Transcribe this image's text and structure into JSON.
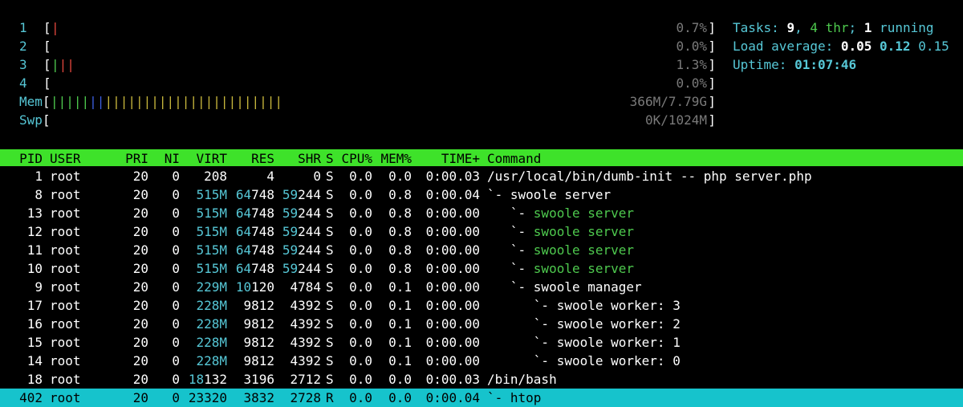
{
  "meters": {
    "cpu1": {
      "label": "1",
      "value": "0.7%",
      "bars": [
        {
          "c": "red",
          "n": 1
        }
      ]
    },
    "cpu2": {
      "label": "2",
      "value": "0.0%",
      "bars": []
    },
    "cpu3": {
      "label": "3",
      "value": "1.3%",
      "bars": [
        {
          "c": "grn",
          "n": 1
        },
        {
          "c": "red",
          "n": 2
        }
      ]
    },
    "cpu4": {
      "label": "4",
      "value": "0.0%",
      "bars": []
    },
    "mem": {
      "label": "Mem",
      "value": "366M/7.79G",
      "bars": [
        {
          "c": "grn",
          "n": 5
        },
        {
          "c": "blu",
          "n": 2
        },
        {
          "c": "yel",
          "n": 23
        }
      ]
    },
    "swp": {
      "label": "Swp",
      "value": "0K/1024M",
      "bars": []
    },
    "bar_char": "|",
    "bracket_open": "[",
    "bracket_close": "]"
  },
  "stats": {
    "tasks_label": "Tasks: ",
    "tasks": "9",
    "sep1": ", ",
    "threads": "4",
    "thr_label": " thr",
    "sep2": "; ",
    "running": "1",
    "running_label": " running",
    "load_label": "Load average: ",
    "load1": "0.05",
    "load5": "0.12",
    "load15": "0.15",
    "uptime_label": "Uptime: ",
    "uptime": "01:07:46"
  },
  "columns": {
    "pid": "PID",
    "user": "USER",
    "pri": "PRI",
    "ni": "NI",
    "virt": "VIRT",
    "res": "RES",
    "shr": "SHR",
    "s": "S",
    "cpu": "CPU%",
    "mem": "MEM%",
    "time": "TIME+",
    "command": "Command"
  },
  "processes": [
    {
      "pid": "1",
      "user": "root",
      "pri": "20",
      "ni": "0",
      "virt": "208",
      "res": "4",
      "shr": "0",
      "s": "S",
      "cpu": "0.0",
      "mem": "0.0",
      "time": "0:00.03",
      "tree": "",
      "cmd": "/usr/local/bin/dumb-init -- php server.php",
      "cmd_color": "white"
    },
    {
      "pid": "8",
      "user": "root",
      "pri": "20",
      "ni": "0",
      "virt": "515M",
      "res": "64748",
      "shr": "59244",
      "s": "S",
      "cpu": "0.0",
      "mem": "0.8",
      "time": "0:00.04",
      "tree": "`- ",
      "cmd": "swoole server",
      "cmd_color": "white"
    },
    {
      "pid": "13",
      "user": "root",
      "pri": "20",
      "ni": "0",
      "virt": "515M",
      "res": "64748",
      "shr": "59244",
      "s": "S",
      "cpu": "0.0",
      "mem": "0.8",
      "time": "0:00.00",
      "tree": "   `- ",
      "cmd": "swoole server",
      "cmd_color": "green"
    },
    {
      "pid": "12",
      "user": "root",
      "pri": "20",
      "ni": "0",
      "virt": "515M",
      "res": "64748",
      "shr": "59244",
      "s": "S",
      "cpu": "0.0",
      "mem": "0.8",
      "time": "0:00.00",
      "tree": "   `- ",
      "cmd": "swoole server",
      "cmd_color": "green"
    },
    {
      "pid": "11",
      "user": "root",
      "pri": "20",
      "ni": "0",
      "virt": "515M",
      "res": "64748",
      "shr": "59244",
      "s": "S",
      "cpu": "0.0",
      "mem": "0.8",
      "time": "0:00.00",
      "tree": "   `- ",
      "cmd": "swoole server",
      "cmd_color": "green"
    },
    {
      "pid": "10",
      "user": "root",
      "pri": "20",
      "ni": "0",
      "virt": "515M",
      "res": "64748",
      "shr": "59244",
      "s": "S",
      "cpu": "0.0",
      "mem": "0.8",
      "time": "0:00.00",
      "tree": "   `- ",
      "cmd": "swoole server",
      "cmd_color": "green"
    },
    {
      "pid": "9",
      "user": "root",
      "pri": "20",
      "ni": "0",
      "virt": "229M",
      "res": "10120",
      "shr": "4784",
      "s": "S",
      "cpu": "0.0",
      "mem": "0.1",
      "time": "0:00.00",
      "tree": "   `- ",
      "cmd": "swoole manager",
      "cmd_color": "white"
    },
    {
      "pid": "17",
      "user": "root",
      "pri": "20",
      "ni": "0",
      "virt": "228M",
      "res": "9812",
      "shr": "4392",
      "s": "S",
      "cpu": "0.0",
      "mem": "0.1",
      "time": "0:00.00",
      "tree": "      `- ",
      "cmd": "swoole worker: 3",
      "cmd_color": "white"
    },
    {
      "pid": "16",
      "user": "root",
      "pri": "20",
      "ni": "0",
      "virt": "228M",
      "res": "9812",
      "shr": "4392",
      "s": "S",
      "cpu": "0.0",
      "mem": "0.1",
      "time": "0:00.00",
      "tree": "      `- ",
      "cmd": "swoole worker: 2",
      "cmd_color": "white"
    },
    {
      "pid": "15",
      "user": "root",
      "pri": "20",
      "ni": "0",
      "virt": "228M",
      "res": "9812",
      "shr": "4392",
      "s": "S",
      "cpu": "0.0",
      "mem": "0.1",
      "time": "0:00.00",
      "tree": "      `- ",
      "cmd": "swoole worker: 1",
      "cmd_color": "white"
    },
    {
      "pid": "14",
      "user": "root",
      "pri": "20",
      "ni": "0",
      "virt": "228M",
      "res": "9812",
      "shr": "4392",
      "s": "S",
      "cpu": "0.0",
      "mem": "0.1",
      "time": "0:00.00",
      "tree": "      `- ",
      "cmd": "swoole worker: 0",
      "cmd_color": "white"
    },
    {
      "pid": "18",
      "user": "root",
      "pri": "20",
      "ni": "0",
      "virt": "18132",
      "res": "3196",
      "shr": "2712",
      "s": "S",
      "cpu": "0.0",
      "mem": "0.0",
      "time": "0:00.03",
      "tree": "",
      "cmd": "/bin/bash",
      "cmd_color": "white"
    },
    {
      "pid": "402",
      "user": "root",
      "pri": "20",
      "ni": "0",
      "virt": "23320",
      "res": "3832",
      "shr": "2728",
      "s": "R",
      "cpu": "0.0",
      "mem": "0.0",
      "time": "0:00.04",
      "tree": "`- ",
      "cmd": "htop",
      "cmd_color": "white",
      "selected": true
    }
  ],
  "colors": {
    "header_bg": "#3ee22a",
    "selected_bg": "#16c3cc",
    "cyan": "#56c7d6",
    "green": "#4ec94e"
  }
}
